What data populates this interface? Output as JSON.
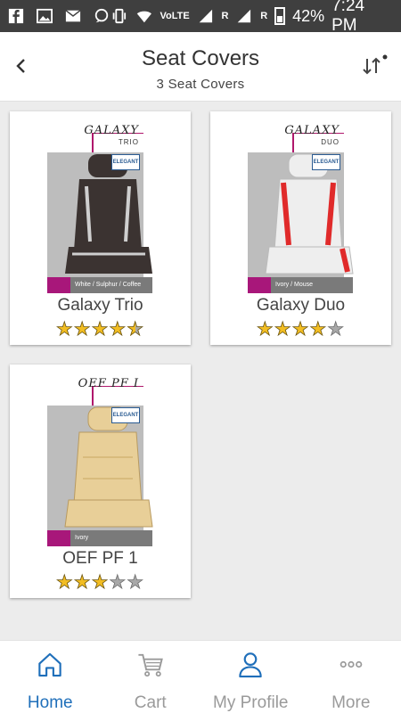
{
  "statusbar": {
    "network": "VoLTE",
    "sim1": "R",
    "sim2": "R",
    "battery": "42%",
    "time": "7:24 PM"
  },
  "header": {
    "title": "Seat Covers",
    "subtitle": "3 Seat Covers"
  },
  "products": [
    {
      "brand": "GALAXY",
      "brand_sub": "TRIO",
      "color_tag": "White / Sulphur / Coffee",
      "name": "Galaxy Trio",
      "rating": 4.5,
      "seat_color": "#3b3331",
      "accent_color": "#cfcfcf"
    },
    {
      "brand": "GALAXY",
      "brand_sub": "DUO",
      "color_tag": "Ivory / Mouse",
      "name": "Galaxy Duo",
      "rating": 4,
      "seat_color": "#eeeeee",
      "accent_color": "#e02a2a"
    },
    {
      "brand": "OEF PF I",
      "brand_sub": "",
      "color_tag": "Ivory",
      "name": "OEF PF 1",
      "rating": 3,
      "seat_color": "#e8cf98",
      "accent_color": "#d8bb7d"
    }
  ],
  "bottom_nav": [
    {
      "label": "Home",
      "icon": "home-icon",
      "active": true
    },
    {
      "label": "Cart",
      "icon": "cart-icon",
      "active": false
    },
    {
      "label": "My Profile",
      "icon": "profile-icon",
      "active": false
    },
    {
      "label": "More",
      "icon": "more-icon",
      "active": false
    }
  ],
  "colors": {
    "accent": "#1f6fba",
    "statusbar": "#3f3f3f",
    "star": "#f2bd22",
    "tag_pink": "#a8177a"
  }
}
